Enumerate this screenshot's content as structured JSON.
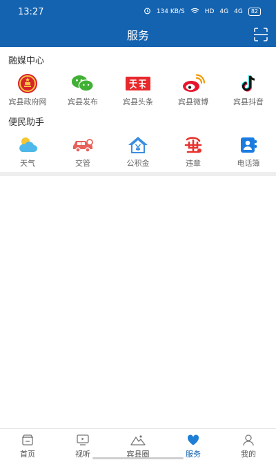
{
  "status_bar": {
    "time": "13:27",
    "net_speed": "134 KB/S",
    "hd": "HD",
    "signal_1": "4G",
    "signal_2": "4G",
    "battery": "82"
  },
  "header": {
    "title": "服务",
    "scan_icon": "scan-icon"
  },
  "sections": [
    {
      "title": "融媒中心",
      "items": [
        {
          "label": "宾县政府网",
          "icon": "government-emblem-icon"
        },
        {
          "label": "宾县发布",
          "icon": "wechat-icon"
        },
        {
          "label": "宾县头条",
          "icon": "toutiao-icon"
        },
        {
          "label": "宾县微博",
          "icon": "weibo-icon"
        },
        {
          "label": "宾县抖音",
          "icon": "douyin-icon"
        }
      ]
    },
    {
      "title": "便民助手",
      "items": [
        {
          "label": "天气",
          "icon": "weather-icon"
        },
        {
          "label": "交管",
          "icon": "car-icon"
        },
        {
          "label": "公积金",
          "icon": "housing-fund-icon"
        },
        {
          "label": "违章",
          "icon": "violation-icon"
        },
        {
          "label": "电话簿",
          "icon": "phonebook-icon"
        }
      ]
    }
  ],
  "tabbar": {
    "tabs": [
      {
        "label": "首页",
        "icon": "home-icon"
      },
      {
        "label": "视听",
        "icon": "tv-icon"
      },
      {
        "label": "宾县圈",
        "icon": "mountain-icon"
      },
      {
        "label": "服务",
        "icon": "heart-icon"
      },
      {
        "label": "我的",
        "icon": "person-icon"
      }
    ],
    "active_tab": "服务"
  },
  "colors": {
    "brand": "#1463b0",
    "active_tab": "#1463b0"
  }
}
